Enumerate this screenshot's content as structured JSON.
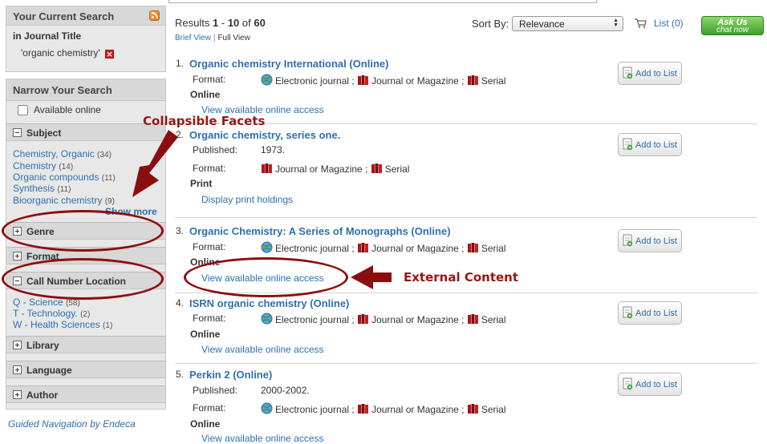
{
  "sidebar": {
    "current_search": {
      "header": "Your Current Search",
      "field_label": "in Journal Title",
      "value": "'organic chemistry'"
    },
    "narrow": {
      "header": "Narrow Your Search",
      "available_online": "Available online",
      "subject": {
        "label": "Subject",
        "values": [
          {
            "name": "Chemistry, Organic",
            "count": "(34)"
          },
          {
            "name": "Chemistry",
            "count": "(14)"
          },
          {
            "name": "Organic compounds",
            "count": "(11)"
          },
          {
            "name": "Synthesis",
            "count": "(11)"
          },
          {
            "name": "Bioorganic chemistry",
            "count": "(9)"
          }
        ],
        "show_more": "Show more"
      },
      "genre": "Genre",
      "format": "Format",
      "call_number": {
        "label": "Call Number Location",
        "values": [
          {
            "name": "Q - Science",
            "count": "(58)"
          },
          {
            "name": "T - Technology.",
            "count": "(2)"
          },
          {
            "name": "W - Health Sciences",
            "count": "(1)"
          }
        ]
      },
      "library": "Library",
      "language": "Language",
      "author": "Author"
    },
    "guided_nav": "Guided Navigation by Endeca"
  },
  "results_header": {
    "prefix": "Results",
    "start": "1",
    "dash": "-",
    "end": "10",
    "of": "of",
    "total": "60",
    "brief_view": "Brief View",
    "separator": "|",
    "full_view": "Full View",
    "sort_by": "Sort By:",
    "sort_value": "Relevance",
    "list_link": "List (0)",
    "ask_us": "Ask Us",
    "chat_now": "chat now"
  },
  "results": [
    {
      "num": "1.",
      "title": "Organic chemistry International (Online)",
      "format_label": "Format:",
      "formats": [
        "Electronic journal",
        "Journal or Magazine",
        "Serial"
      ],
      "availability": "Online",
      "access_link": "View available online access",
      "add_label": "Add to List"
    },
    {
      "num": "2.",
      "title": "Organic chemistry, series one.",
      "published_label": "Published:",
      "published": "1973.",
      "format_label": "Format:",
      "formats": [
        "Journal or Magazine",
        "Serial"
      ],
      "availability": "Print",
      "access_link": "Display print holdings",
      "add_label": "Add to List"
    },
    {
      "num": "3.",
      "title": "Organic Chemistry: A Series of Monographs (Online)",
      "format_label": "Format:",
      "formats": [
        "Electronic journal",
        "Journal or Magazine",
        "Serial"
      ],
      "availability": "Online",
      "access_link": "View available online access",
      "add_label": "Add to List"
    },
    {
      "num": "4.",
      "title": "ISRN organic chemistry (Online)",
      "format_label": "Format:",
      "formats": [
        "Electronic journal",
        "Journal or Magazine",
        "Serial"
      ],
      "availability": "Online",
      "access_link": "View available online access",
      "add_label": "Add to List"
    },
    {
      "num": "5.",
      "title": "Perkin 2 (Online)",
      "published_label": "Published:",
      "published": "2000-2002.",
      "format_label": "Format:",
      "formats": [
        "Electronic journal",
        "Journal or Magazine",
        "Serial"
      ],
      "availability": "Online",
      "access_link": "View available online access",
      "add_label": "Add to List"
    }
  ],
  "annotations": {
    "collapsible": "Collapsible Facets",
    "external": "External Content"
  },
  "colors": {
    "link": "#2f6fb0",
    "annotation": "#8b0e0e",
    "sidebar_bg": "#e8e8e8",
    "ask_us_green": "#3aa12a"
  },
  "icons": [
    "rss-icon",
    "remove-icon",
    "plus-icon",
    "minus-icon",
    "cart-icon",
    "globe-icon",
    "books-icon",
    "add-to-list-icon"
  ]
}
